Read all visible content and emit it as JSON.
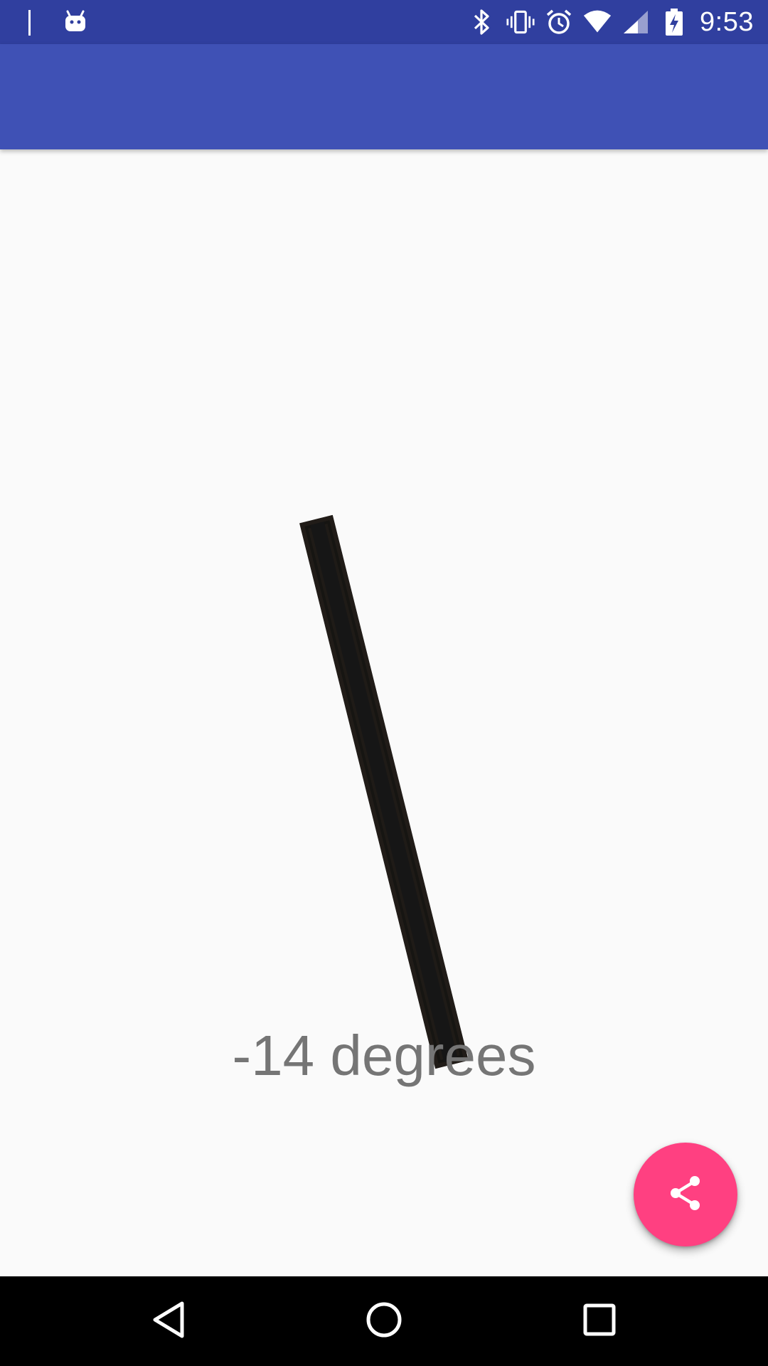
{
  "status_bar": {
    "time": "9:53",
    "icons": [
      "android-debug-icon",
      "bluetooth-icon",
      "vibrate-icon",
      "alarm-icon",
      "wifi-icon",
      "cell-signal-icon",
      "battery-charging-icon"
    ]
  },
  "app_bar": {
    "title": ""
  },
  "level": {
    "angle_degrees": -14
  },
  "readout": {
    "label": "-14 degrees"
  },
  "fab": {
    "icon": "share-icon"
  },
  "nav_bar": {
    "buttons": [
      "back-icon",
      "home-icon",
      "recents-icon"
    ]
  },
  "colors": {
    "status_bar": "#303f9f",
    "app_bar": "#3f51b5",
    "accent": "#ff4081",
    "background": "#fafafa",
    "readout_text": "#757575"
  }
}
